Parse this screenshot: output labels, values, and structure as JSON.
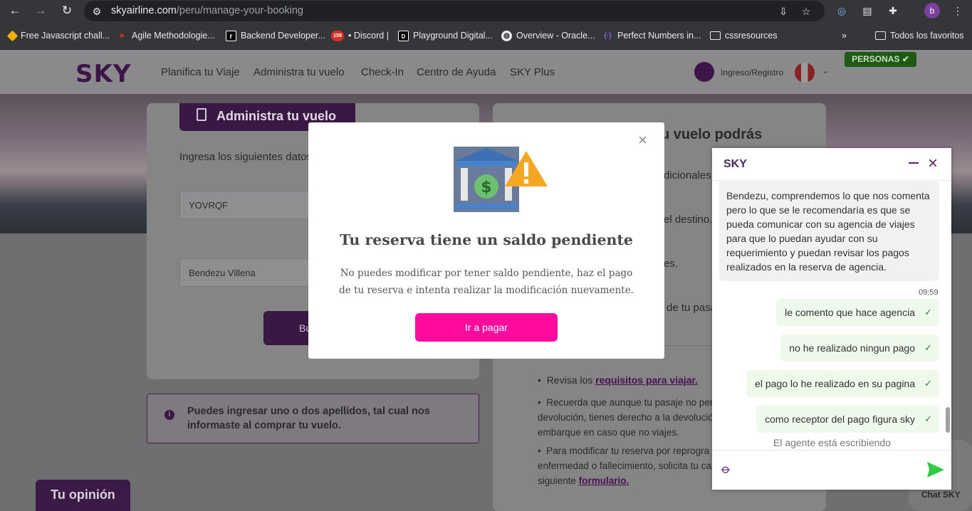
{
  "browser": {
    "url_domain": "skyairline.com",
    "url_path": "/peru/manage-your-booking",
    "profile_initial": "b",
    "bookmarks": [
      {
        "label": "Free Javascript chall...",
        "icon_color": "#f9ab00"
      },
      {
        "label": "Agile Methodologie...",
        "icon_color": "#d93025"
      },
      {
        "label": "Backend Developer...",
        "icon_color": "#000000"
      },
      {
        "label": "• Discord |",
        "icon_color": "#d93025",
        "badge": "158"
      },
      {
        "label": "Playground Digital...",
        "icon_color": "#000000"
      },
      {
        "label": "Overview - Oracle...",
        "icon_color": "#e8eaed"
      },
      {
        "label": "Perfect Numbers in...",
        "icon_color": "#5a2ca0"
      },
      {
        "label": "cssresources",
        "icon_color": "folder"
      }
    ],
    "all_bookmarks": "Todos los favoritos"
  },
  "site": {
    "logo": "SKY",
    "nav": [
      "Planifica tu Viaje",
      "Administra tu vuelo",
      "Check-In",
      "Centro de Ayuda",
      "SKY Plus"
    ],
    "login": "Ingreso/Registro",
    "personas": "PERSONAS",
    "card_tab": "Administra tu vuelo",
    "card_intro": "Ingresa los siguientes datos",
    "code_value": "YOVRQF",
    "lastname_value": "Bendezu Villena",
    "search_btn": "Bu",
    "info_text": "Puedes ingresar uno o dos apellidos, tal cual nos informaste al comprar tu vuelo.",
    "right_heading": "u vuelo podrás",
    "right_frags": [
      "dicionales a",
      "el destino.",
      "es.",
      "de tu pasa"
    ],
    "bullets": {
      "b1_prefix": "Revisa los ",
      "b1_link": "requisitos para viajar.",
      "b2": "Recuerda que aunque tu pasaje no per",
      "b2_l2": "devolución, tienes derecho a la devolución",
      "b2_l3": "embarque en caso que no viajes.",
      "b3": "Para modificar tu reserva por reprogra",
      "b3_l2": "enfermedad o fallecimiento, solicita tu car",
      "b3_l3": "siguiente ",
      "b3_link": "formulario."
    },
    "opinion": "Tu opinión",
    "chat_launcher": "Chat SKY"
  },
  "modal": {
    "title": "Tu reserva tiene un saldo pendiente",
    "text": "No puedes modificar por tener saldo pendiente, haz el pago de tu reserva e intenta realizar la modificación nuevamente.",
    "button": "Ir a pagar"
  },
  "chat": {
    "title": "SKY",
    "agent_message": "Bendezu, comprendemos lo que nos comenta pero lo que se le recomendaría es que se pueda comunicar con su agencia de viajes para que lo puedan ayudar con su requerimiento y puedan revisar los pagos realizados en la reserva de agencia.",
    "time": "09:59",
    "user_messages": [
      "le comento que hace agencia",
      "no he realizado ningun pago",
      "el pago lo he realizado en su pagina",
      "como receptor del pago figura sky"
    ],
    "typing": "El agente está escribiendo"
  },
  "colors": {
    "accent_pink": "#ff0b9d",
    "brand_purple": "#5a1f6e",
    "send_green": "#2ecc40"
  }
}
